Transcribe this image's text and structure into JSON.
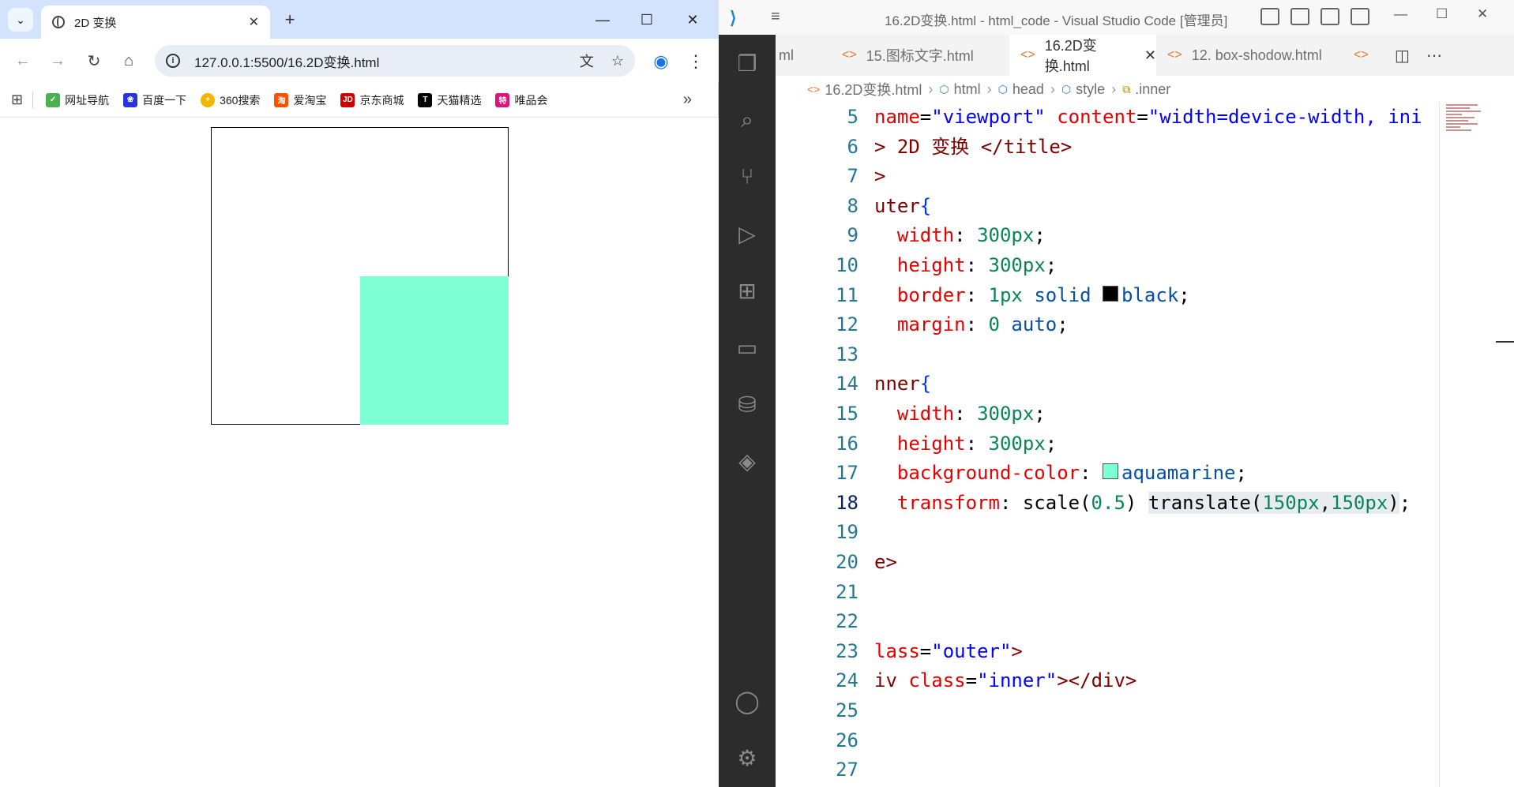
{
  "browser": {
    "tab_title": "2D 变换",
    "url": "127.0.0.1:5500/16.2D变换.html",
    "bookmarks": [
      "网址导航",
      "百度一下",
      "360搜索",
      "爱淘宝",
      "京东商城",
      "天猫精选",
      "唯品会"
    ],
    "bookmark_more": "»",
    "page": {
      "outer_color": "#000000",
      "inner_color": "#7fffd4"
    }
  },
  "vscode": {
    "window_title": "16.2D变换.html - html_code - Visual Studio Code [管理员]",
    "tabs": [
      {
        "label": "ml",
        "active": false
      },
      {
        "label": "15.图标文字.html",
        "active": false
      },
      {
        "label": "16.2D变换.html",
        "active": true
      },
      {
        "label": "12. box-shodow.html",
        "active": false
      }
    ],
    "breadcrumbs": [
      "16.2D变换.html",
      "html",
      "head",
      "style",
      ".inner"
    ],
    "current_line": 18,
    "lines": [
      {
        "n": "5"
      },
      {
        "n": "6"
      },
      {
        "n": "7"
      },
      {
        "n": "8"
      },
      {
        "n": "9"
      },
      {
        "n": "10"
      },
      {
        "n": "11"
      },
      {
        "n": "12"
      },
      {
        "n": "13"
      },
      {
        "n": "14"
      },
      {
        "n": "15"
      },
      {
        "n": "16"
      },
      {
        "n": "17"
      },
      {
        "n": "18"
      },
      {
        "n": "19"
      },
      {
        "n": "20"
      },
      {
        "n": "21"
      },
      {
        "n": "22"
      },
      {
        "n": "23"
      },
      {
        "n": "24"
      },
      {
        "n": "25"
      },
      {
        "n": "26"
      },
      {
        "n": "27"
      }
    ],
    "code": {
      "l5a": "name",
      "l5b": "=",
      "l5c": "\"viewport\"",
      "l5d": " content",
      "l5e": "=",
      "l5f": "\"width=device-width, ini",
      "l6a": "> 2D 变换 ",
      "l6b": "</title>",
      "l7a": ">",
      "l8a": "uter",
      "l8b": "{",
      "l9a": "width",
      "l9b": ": ",
      "l9c": "300px",
      "l9d": ";",
      "l10a": "height",
      "l10b": ": ",
      "l10c": "300px",
      "l10d": ";",
      "l11a": "border",
      "l11b": ": ",
      "l11c": "1px",
      "l11d": " solid ",
      "l11e": "black",
      "l11f": ";",
      "l12a": "margin",
      "l12b": ": ",
      "l12c": "0",
      "l12d": " auto",
      "l12e": ";",
      "l14a": "nner",
      "l14b": "{",
      "l15a": "width",
      "l15b": ": ",
      "l15c": "300px",
      "l15d": ";",
      "l16a": "height",
      "l16b": ": ",
      "l16c": "300px",
      "l16d": ";",
      "l17a": "background-color",
      "l17b": ": ",
      "l17c": "aquamarine",
      "l17d": ";",
      "l18a": "transform",
      "l18b": ": scale(",
      "l18c": "0.5",
      "l18d": ") ",
      "l18e": "translate(",
      "l18f": "150px",
      "l18g": ",",
      "l18h": "150px",
      "l18i": ")",
      "l18j": ";",
      "l20a": "e>",
      "l23a": "lass",
      "l23b": "=",
      "l23c": "\"outer\"",
      "l23d": ">",
      "l24a": "iv",
      "l24b": " class",
      "l24c": "=",
      "l24d": "\"inner\"",
      "l24e": "></div>"
    },
    "swatch_black": "#000000",
    "swatch_aquamarine": "#7fffd4"
  }
}
